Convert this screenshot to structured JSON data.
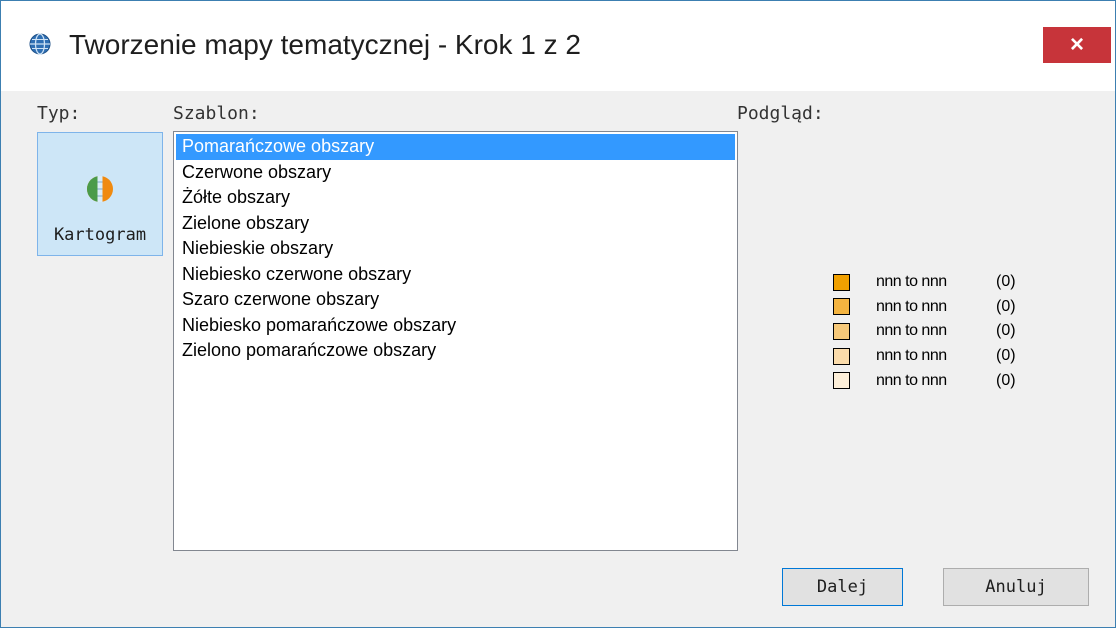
{
  "window": {
    "title": "Tworzenie mapy tematycznej - Krok 1 z 2",
    "close_label": "×"
  },
  "labels": {
    "type": "Typ:",
    "template": "Szablon:",
    "preview": "Podgląd:"
  },
  "type_button": {
    "label": "Kartogram",
    "icon": "globe-region-icon"
  },
  "templates": {
    "selected_index": 0,
    "items": [
      "Pomarańczowe obszary",
      "Czerwone obszary",
      "Żółte obszary",
      "Zielone obszary",
      "Niebieskie obszary",
      "Niebiesko czerwone obszary",
      "Szaro czerwone obszary",
      "Niebiesko pomarańczowe obszary",
      "Zielono pomarańczowe obszary"
    ]
  },
  "legend": [
    {
      "range": "nnn to nnn",
      "count": "(0)",
      "color": "#f0a000"
    },
    {
      "range": "nnn to nnn",
      "count": "(0)",
      "color": "#f4b440"
    },
    {
      "range": "nnn to nnn",
      "count": "(0)",
      "color": "#f7c979"
    },
    {
      "range": "nnn to nnn",
      "count": "(0)",
      "color": "#fbdcab"
    },
    {
      "range": "nnn to nnn",
      "count": "(0)",
      "color": "#fdefd9"
    }
  ],
  "buttons": {
    "next": "Dalej",
    "cancel": "Anuluj"
  },
  "colors": {
    "selection": "#3399ff",
    "close_button": "#c7343a",
    "window_border": "#3c7fb1"
  }
}
